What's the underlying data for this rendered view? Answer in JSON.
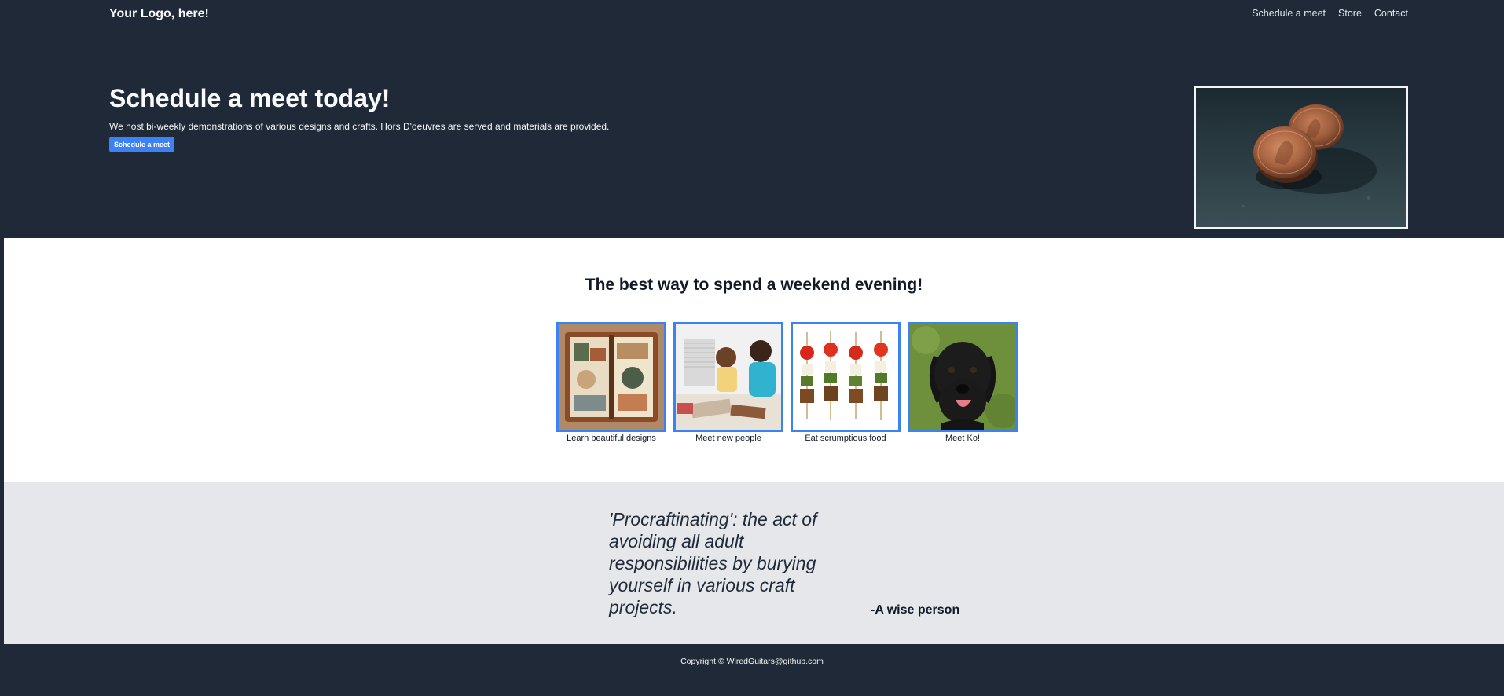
{
  "header": {
    "logo": "Your Logo, here!",
    "nav": [
      "Schedule a meet",
      "Store",
      "Contact"
    ]
  },
  "hero": {
    "title": "Schedule a meet today!",
    "text": "We host bi-weekly demonstrations of various designs and crafts. Hors D'oeuvres are served and materials are provided.",
    "button": "Schedule a meet"
  },
  "features": {
    "title": "The best way to spend a weekend evening!",
    "cards": [
      {
        "caption": "Learn beautiful designs"
      },
      {
        "caption": "Meet new people"
      },
      {
        "caption": "Eat scrumptious food"
      },
      {
        "caption": "Meet Ko!"
      }
    ]
  },
  "quote": {
    "text": "'Procraftinating': the act of avoiding all adult responsibilities by burying yourself in various craft projects.",
    "author": "-A wise person"
  },
  "footer": {
    "copyright": "Copyright © WiredGuitars@github.com"
  },
  "colors": {
    "background": "#1f2937",
    "accent": "#3b82f6",
    "quote_bg": "#e5e7eb"
  }
}
